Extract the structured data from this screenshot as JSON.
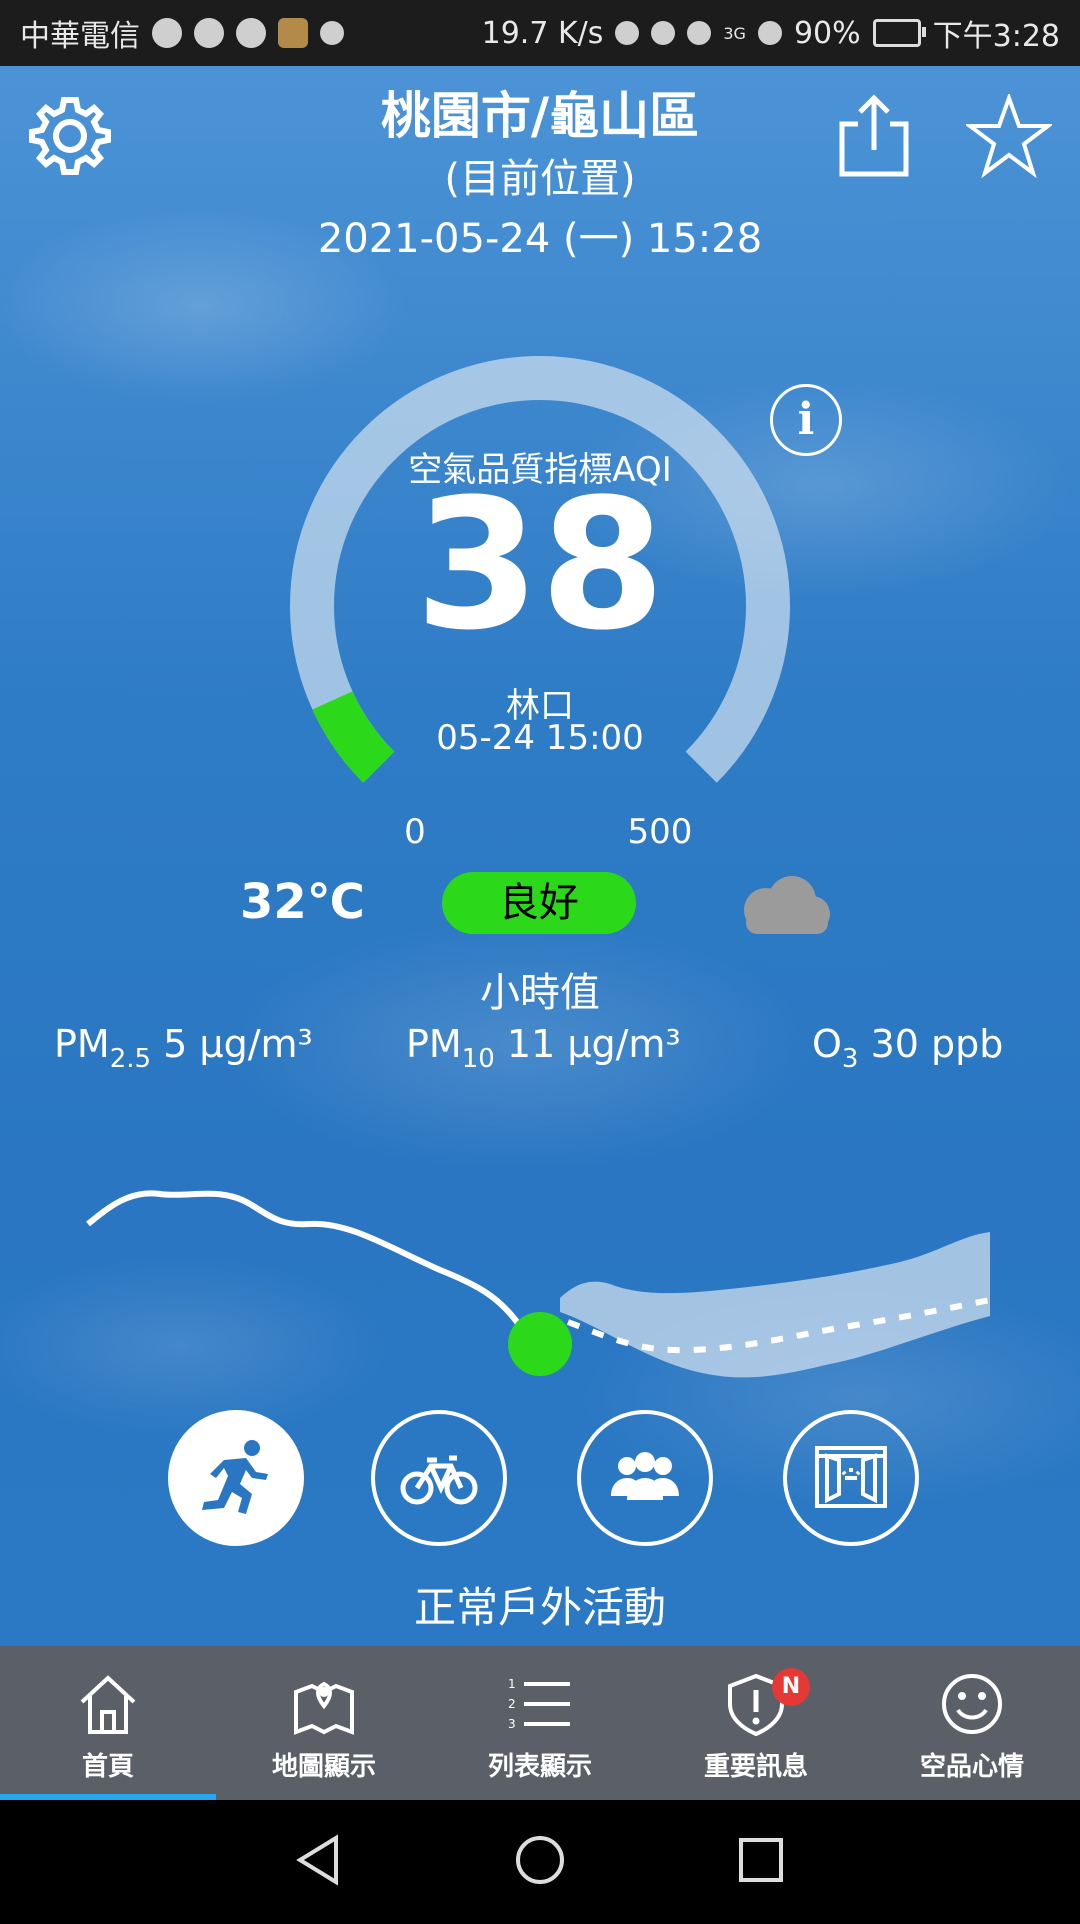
{
  "status_bar": {
    "carrier": "中華電信",
    "net_speed": "19.7 K/s",
    "network": "3G",
    "battery": "90%",
    "time": "下午3:28"
  },
  "header": {
    "location": "桃園市/龜山區",
    "sublocation": "(目前位置)",
    "datetime": "2021-05-24 (一) 15:28"
  },
  "aqi": {
    "label": "空氣品質指標AQI",
    "value": "38",
    "station": "林口",
    "station_time": "05-24 15:00",
    "scale_min": "0",
    "scale_max": "500",
    "level_fraction": 0.076,
    "level_color": "#2bd91a"
  },
  "weather": {
    "temperature": "32℃",
    "status": "良好",
    "icon": "cloud-icon"
  },
  "hourly": {
    "title": "小時值",
    "pm25": {
      "name": "PM",
      "sub": "2.5",
      "value": "5 μg/m³"
    },
    "pm10": {
      "name": "PM",
      "sub": "10",
      "value": "11 μg/m³"
    },
    "o3": {
      "name": "O",
      "sub": "3",
      "value": "30 ppb"
    }
  },
  "activities": {
    "icons": [
      "running-icon",
      "bicycle-icon",
      "group-icon",
      "window-icon"
    ],
    "text": "正常戶外活動"
  },
  "bottom_nav": [
    {
      "label": "首頁",
      "icon": "home-icon",
      "active": true
    },
    {
      "label": "地圖顯示",
      "icon": "map-icon"
    },
    {
      "label": "列表顯示",
      "icon": "list-icon"
    },
    {
      "label": "重要訊息",
      "icon": "alert-icon",
      "badge": "N"
    },
    {
      "label": "空品心情",
      "icon": "smiley-icon"
    }
  ],
  "colors": {
    "accent_green": "#2bd91a",
    "nav_bg": "#5b6068",
    "nav_active": "#2aa5f0",
    "badge_red": "#e53935"
  }
}
